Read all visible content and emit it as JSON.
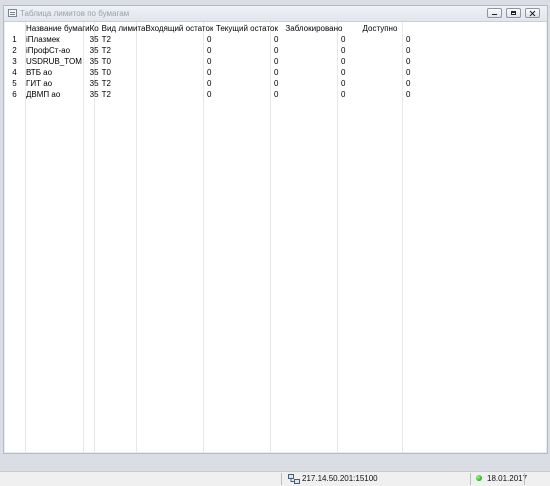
{
  "window": {
    "title": "Таблица лимитов по бумагам",
    "controls": [
      "minimize-icon",
      "maximize-icon",
      "close-icon"
    ]
  },
  "table": {
    "columns": [
      "",
      "Название бумаги",
      "Ко",
      "Вид лимита",
      "Входящий остаток",
      "Текущий остаток",
      "Заблокировано",
      "Доступно"
    ],
    "rows": [
      [
        "1",
        "iПлазмек",
        "35",
        "T2",
        "0",
        "0",
        "0",
        "0"
      ],
      [
        "2",
        "iПрофСт-ао",
        "35",
        "T2",
        "0",
        "0",
        "0",
        "0"
      ],
      [
        "3",
        "USDRUB_TOM",
        "35",
        "T0",
        "0",
        "0",
        "0",
        "0"
      ],
      [
        "4",
        "ВТБ ао",
        "35",
        "T0",
        "0",
        "0",
        "0",
        "0"
      ],
      [
        "5",
        "ГИТ ао",
        "35",
        "T2",
        "0",
        "0",
        "0",
        "0"
      ],
      [
        "6",
        "ДВМП ао",
        "35",
        "T2",
        "0",
        "0",
        "0",
        "0"
      ]
    ]
  },
  "statusbar": {
    "server": "217.14.50.201:15100",
    "date": "18.01.2017",
    "connection_status_color": "#1fae1f"
  }
}
